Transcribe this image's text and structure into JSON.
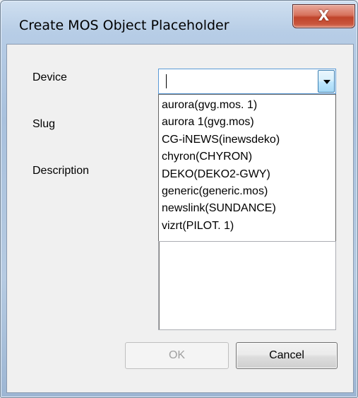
{
  "window": {
    "title": "Create MOS Object Placeholder",
    "close_glyph": "X"
  },
  "form": {
    "device_label": "Device",
    "slug_label": "Slug",
    "description_label": "Description",
    "device_value": ""
  },
  "dropdown": {
    "options": [
      "aurora(gvg.mos. 1)",
      "aurora 1(gvg.mos)",
      "CG-iNEWS(inewsdeko)",
      "chyron(CHYRON)",
      "DEKO(DEKO2-GWY)",
      "generic(generic.mos)",
      "newslink(SUNDANCE)",
      "vizrt(PILOT. 1)"
    ]
  },
  "buttons": {
    "ok_label": "OK",
    "cancel_label": "Cancel"
  },
  "icons": {
    "close": "close-icon",
    "dropdown_arrow": "chevron-down-icon"
  },
  "colors": {
    "close_button": "#c9563d",
    "focus_border": "#5a9ad6",
    "disabled_text": "#a0a0a0"
  }
}
